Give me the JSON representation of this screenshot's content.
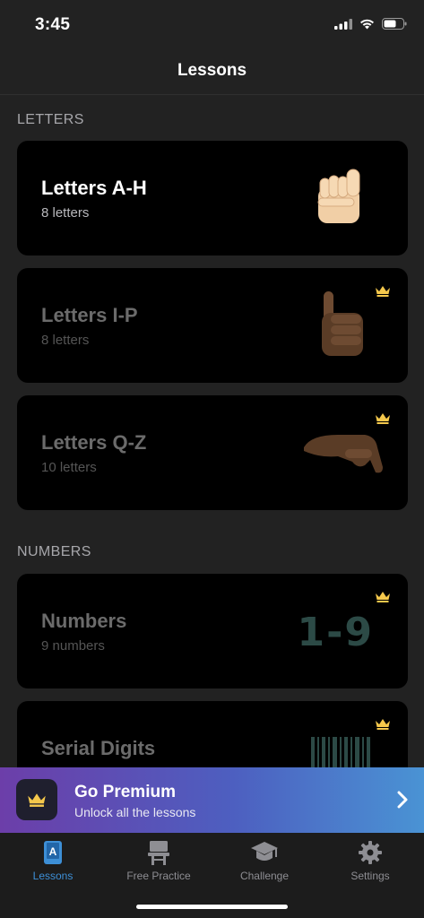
{
  "status_bar": {
    "time": "3:45"
  },
  "nav": {
    "title": "Lessons"
  },
  "sections": {
    "letters": "LETTERS",
    "numbers": "NUMBERS"
  },
  "lessons": [
    {
      "title": "Letters A-H",
      "subtitle": "8 letters",
      "locked": false,
      "icon": "hand-fist-icon"
    },
    {
      "title": "Letters I-P",
      "subtitle": "8 letters",
      "locked": true,
      "icon": "hand-pinky-icon"
    },
    {
      "title": "Letters Q-Z",
      "subtitle": "10 letters",
      "locked": true,
      "icon": "hand-sideways-icon"
    },
    {
      "title": "Numbers",
      "subtitle": "9 numbers",
      "locked": true,
      "art_text": "1-9"
    },
    {
      "title": "Serial Digits",
      "subtitle": "",
      "locked": true,
      "icon": "barcode-icon"
    }
  ],
  "premium": {
    "title": "Go Premium",
    "subtitle": "Unlock all the lessons",
    "icon": "crown-icon"
  },
  "tabs": [
    {
      "label": "Lessons",
      "icon": "book-icon",
      "active": true
    },
    {
      "label": "Free Practice",
      "icon": "easel-icon",
      "active": false
    },
    {
      "label": "Challenge",
      "icon": "graduation-cap-icon",
      "active": false
    },
    {
      "label": "Settings",
      "icon": "gear-icon",
      "active": false
    }
  ],
  "colors": {
    "background": "#222222",
    "card": "#000000",
    "crown": "#f5c84c",
    "tab_active": "#3d8fd6"
  }
}
